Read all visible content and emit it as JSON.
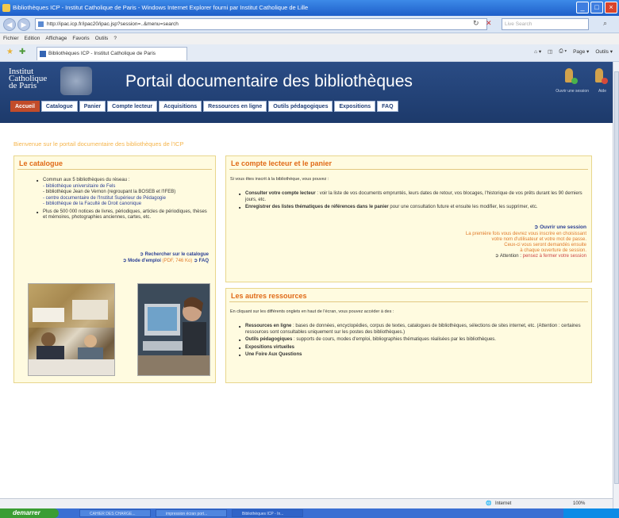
{
  "window": {
    "title": "Bibliothèques ICP - Institut Catholique de Paris - Windows Internet Explorer fourni par Institut Catholique de Lille"
  },
  "browser": {
    "url": "http://ipac.icp.fr/ipac20/ipac.jsp?session=..&menu=search",
    "search_placeholder": "Live Search",
    "menu": [
      "Fichier",
      "Edition",
      "Affichage",
      "Favoris",
      "Outils",
      "?"
    ],
    "tab_title": "Bibliothèques ICP - Institut Catholique de Paris",
    "commands": [
      "Page ▾",
      "Outils ▾"
    ],
    "status_zone": "Internet",
    "zoom": "100%"
  },
  "header": {
    "logo_lines": [
      "Institut",
      "Catholique",
      "de Paris"
    ],
    "title": "Portail documentaire des bibliothèques",
    "icon_labels": [
      "Ouvrir une session",
      "Aide"
    ],
    "tabs": [
      "Accueil",
      "Catalogue",
      "Panier",
      "Compte lecteur",
      "Acquisitions",
      "Ressources en ligne",
      "Outils pédagogiques",
      "Expositions",
      "FAQ"
    ]
  },
  "welcome": "Bienvenue sur le portail documentaire des bibliothèques de l'ICP",
  "catalogue": {
    "title": "Le catalogue",
    "intro": "Commun aux 5 bibliothèques du réseau :",
    "libraries": [
      "- bibliothèque universitaire de Fels",
      "- bibliothèque Jean de Vernon (regroupant la BOSEB et l'IFEB)",
      "- centre documentaire de l'Institut Supérieur de Pédagogie",
      "- bibliothèque de la Faculté de Droit canonique"
    ],
    "second": "Plus de 500 000 notices de livres, périodiques, articles de périodiques, thèses et mémoires, photographies anciennes, cartes, etc.",
    "link_search": "Rechercher sur le catalogue",
    "link_mode": "Mode d'emploi",
    "link_mode_info": "(PDF, 746 Ko)",
    "link_faq": "FAQ"
  },
  "account": {
    "title": "Le compte lecteur et le panier",
    "intro": "Si vous êtes inscrit à la bibliothèque, vous pouvez :",
    "item1_bold": "Consulter votre compte lecteur",
    "item1": " : voir la liste de vos documents empruntés, leurs dates de retour, vos blocages, l'historique de vos prêts durant les 90 derniers jours, etc.",
    "item2_bold": "Enregistrer des listes thématiques de références dans le panier",
    "item2": " pour une consultation future et ensuite les modifier, les supprimer, etc.",
    "link_session": "Ouvrir une session",
    "note": [
      "La première fois vous devrez vous inscrire en choisissant",
      "votre nom d'utilisateur et votre mot de passe.",
      "Ceux-ci vous seront demandés ensuite",
      "à chaque ouverture de session."
    ],
    "warn_prefix": "Attention :",
    "warn_link": "pensez à fermer votre session"
  },
  "resources": {
    "title": "Les autres ressources",
    "intro": "En cliquant sur les différents onglets en haut de l'écran, vous pouvez accéder à des :",
    "item1_bold": "Ressources en ligne",
    "item1": " : bases de données, encyclopédies, corpus de textes, catalogues de bibliothèques, sélections de sites internet, etc. (Attention : certaines ressources sont consultables uniquement sur les postes des bibliothèques.)",
    "item2_bold": "Outils pédagogiques",
    "item2": " : supports de cours, modes d'emploi, bibliographies thématiques réalisées par les bibliothèques.",
    "item3": "Expositions virtuelles",
    "item4": "Une Foire Aux Questions"
  },
  "taskbar": {
    "start": "demarrer",
    "tasks": [
      "CAHIER DES CHARGE...",
      "impression écran port...",
      "Bibliothèques ICP - In..."
    ]
  }
}
